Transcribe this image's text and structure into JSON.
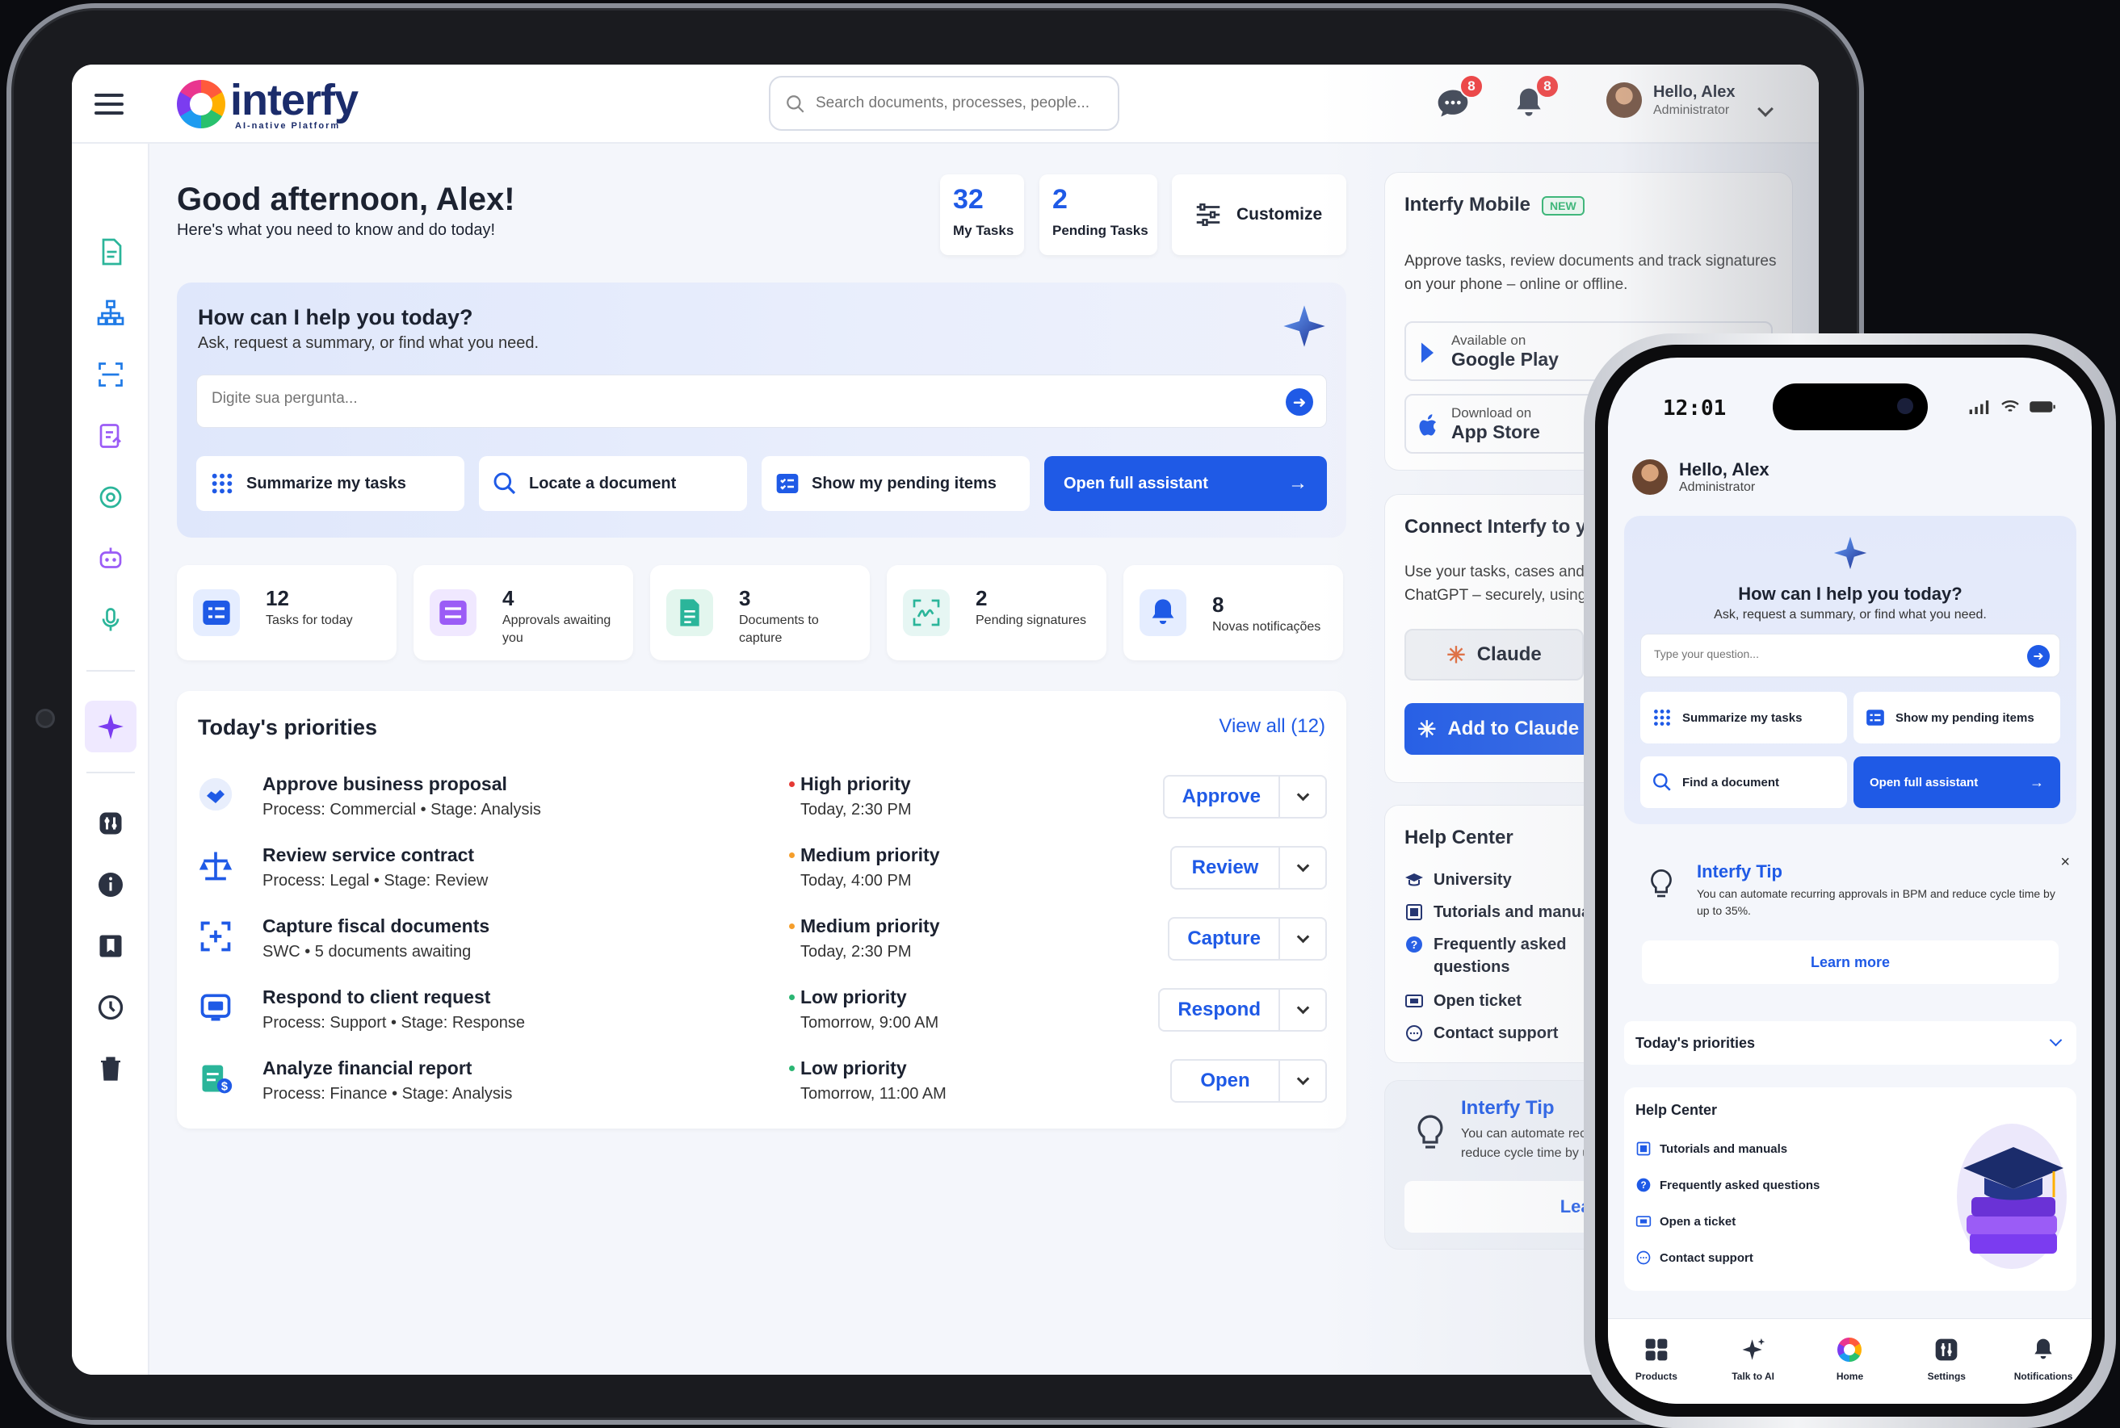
{
  "brand": {
    "name": "interfy",
    "tagline": "AI-native Platform"
  },
  "topbar": {
    "search_placeholder": "Search documents, processes, people...",
    "messages_badge": "8",
    "notifications_badge": "8",
    "user_name": "Hello, Alex",
    "user_role": "Administrator"
  },
  "sidebar": {
    "icons": [
      "documents-icon",
      "org-chart-icon",
      "scan-icon",
      "forms-icon",
      "settings-gear-icon",
      "robot-icon",
      "microphone-icon",
      "ai-sparkle-icon",
      "integrations-icon",
      "info-icon",
      "bookmark-icon",
      "history-icon",
      "trash-icon"
    ]
  },
  "header": {
    "greeting": "Good afternoon, Alex!",
    "subtitle": "Here's what you need to know and do today!",
    "my_tasks_count": "32",
    "my_tasks_label": "My Tasks",
    "pending_tasks_count": "2",
    "pending_tasks_label": "Pending Tasks",
    "customize_label": "Customize"
  },
  "assistant": {
    "title": "How can I help you today?",
    "subtitle": "Ask, request a summary, or find what you need.",
    "placeholder": "Digite sua pergunta...",
    "chips": {
      "summarize": "Summarize my tasks",
      "locate": "Locate a document",
      "pending": "Show my pending items",
      "open": "Open full assistant"
    }
  },
  "stats": [
    {
      "num": "12",
      "label": "Tasks for today"
    },
    {
      "num": "4",
      "label": "Approvals awaiting you"
    },
    {
      "num": "3",
      "label": "Documents to capture"
    },
    {
      "num": "2",
      "label": "Pending signatures"
    },
    {
      "num": "8",
      "label": "Novas notificações"
    }
  ],
  "priorities": {
    "title": "Today's priorities",
    "view_all": "View all (12)",
    "rows": [
      {
        "title": "Approve business proposal",
        "sub": "Process: Commercial • Stage: Analysis",
        "priority": "High priority",
        "when": "Today, 2:30 PM",
        "action": "Approve",
        "dot": "#e53935"
      },
      {
        "title": "Review service contract",
        "sub": "Process: Legal • Stage: Review",
        "priority": "Medium priority",
        "when": "Today, 4:00 PM",
        "action": "Review",
        "dot": "#f59e2b"
      },
      {
        "title": "Capture fiscal documents",
        "sub": "SWC • 5 documents awaiting",
        "priority": "Medium priority",
        "when": "Today, 2:30 PM",
        "action": "Capture",
        "dot": "#f59e2b"
      },
      {
        "title": "Respond to client request",
        "sub": "Process: Support • Stage: Response",
        "priority": "Low priority",
        "when": "Tomorrow, 9:00 AM",
        "action": "Respond",
        "dot": "#2bb673"
      },
      {
        "title": "Analyze financial report",
        "sub": "Process: Finance • Stage: Analysis",
        "priority": "Low priority",
        "when": "Tomorrow, 11:00 AM",
        "action": "Open",
        "dot": "#2bb673"
      }
    ]
  },
  "mobile_panel": {
    "title": "Interfy Mobile",
    "tag": "NEW",
    "text": "Approve tasks, review documents and track signatures on your phone – online or offline.",
    "gp_small": "Available on",
    "gp_big": "Google Play",
    "as_small": "Download on",
    "as_big": "App Store"
  },
  "connect_panel": {
    "title": "Connect Interfy to you",
    "text": "Use your tasks, cases and ChatGPT – securely, using",
    "claude": "Claude",
    "add_claude": "Add to Claude"
  },
  "help_panel": {
    "title": "Help Center",
    "items": [
      "University",
      "Tutorials and manuals",
      "Frequently asked questions",
      "Open ticket",
      "Contact support"
    ]
  },
  "tip_panel": {
    "title": "Interfy Tip",
    "text": "You can automate recu reduce cycle time by u",
    "button": "Learn r"
  },
  "phone": {
    "time": "12:01",
    "user_name": "Hello, Alex",
    "user_role": "Administrator",
    "assistant_title": "How can I help you today?",
    "assistant_sub": "Ask, request a summary, or find what you need.",
    "placeholder": "Type your question...",
    "chips": {
      "summarize": "Summarize my tasks",
      "pending": "Show my pending items",
      "find": "Find a document",
      "open": "Open full assistant"
    },
    "tip_title": "Interfy Tip",
    "tip_text": "You can automate recurring approvals in BPM and reduce cycle time by up to 35%.",
    "tip_button": "Learn more",
    "priorities": "Today's priorities",
    "help_title": "Help Center",
    "help_items": [
      "Tutorials and manuals",
      "Frequently asked questions",
      "Open a ticket",
      "Contact support"
    ],
    "nav": [
      "Products",
      "Talk to AI",
      "Home",
      "Settings",
      "Notifications"
    ]
  }
}
